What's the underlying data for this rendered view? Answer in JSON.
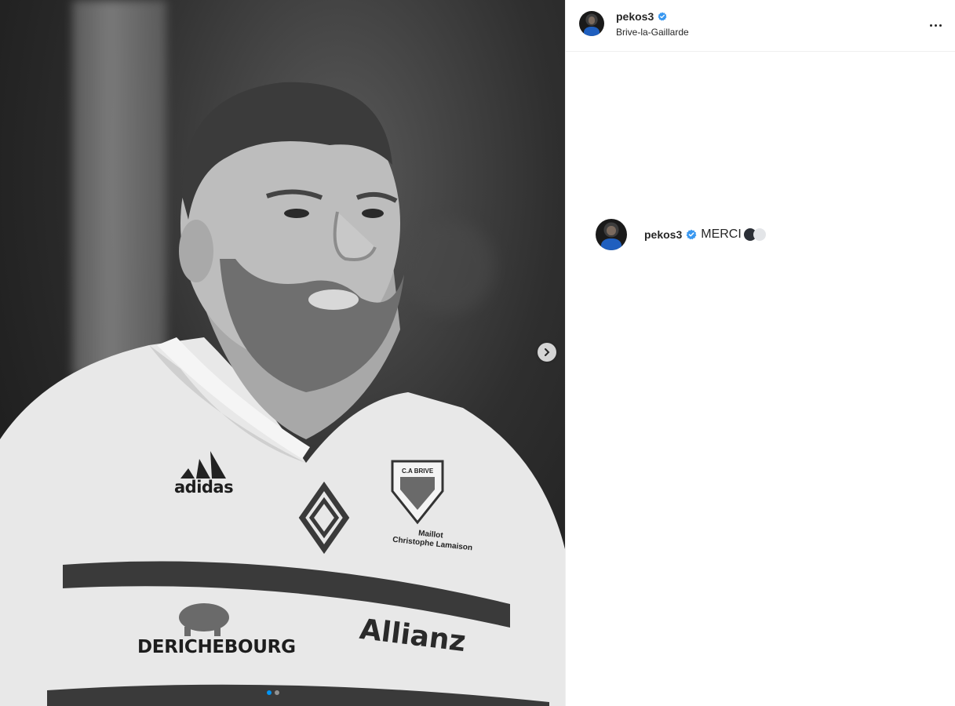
{
  "post": {
    "username": "pekos3",
    "location": "Brive-la-Gaillarde",
    "verified": true,
    "caption_text": "MERCI",
    "caption_emojis": [
      "dark-circle-emoji",
      "white-circle-emoji"
    ]
  },
  "jersey": {
    "brand": "adidas",
    "club_badge": "C.A BRIVE",
    "label_line1": "Maillot",
    "label_line2": "Christophe Lamaison",
    "sponsor_left": "DERICHEBOURG",
    "sponsor_right": "Allianz"
  },
  "carousel": {
    "current_index": 1,
    "total": 2
  },
  "colors": {
    "verified_blue": "#3897f0",
    "active_dot": "#0095f6"
  },
  "icons": [
    "verified-badge-icon",
    "more-options-icon",
    "chevron-right-icon"
  ]
}
